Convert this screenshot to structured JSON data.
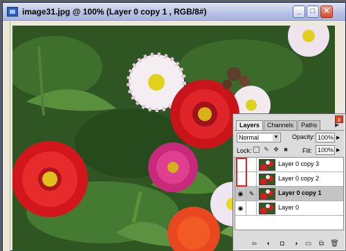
{
  "document": {
    "title": "image31.jpg @ 100% (Layer 0 copy 1 , RGB/8#)",
    "minimize": "_",
    "maximize": "□",
    "close": "✕"
  },
  "layers_panel": {
    "close": "x",
    "menu": "▶",
    "tabs": [
      {
        "label": "Layers",
        "active": true
      },
      {
        "label": "Channels",
        "active": false
      },
      {
        "label": "Paths",
        "active": false
      }
    ],
    "blend_mode": "Normal",
    "opacity_label": "Opacity:",
    "opacity_value": "100%",
    "lock_label": "Lock:",
    "fill_label": "Fill:",
    "fill_value": "100%",
    "layers": [
      {
        "name": "Layer 0 copy 3",
        "visible": false,
        "selected": false
      },
      {
        "name": "Layer 0 copy 2",
        "visible": false,
        "selected": false
      },
      {
        "name": "Layer 0 copy 1",
        "visible": true,
        "selected": true
      },
      {
        "name": "Layer 0",
        "visible": true,
        "selected": false
      }
    ],
    "icons": {
      "eye": "👁",
      "brush": "🖌"
    }
  },
  "colors": {
    "highlight": "#e0211b",
    "selected_row": "#c4c4c4"
  }
}
